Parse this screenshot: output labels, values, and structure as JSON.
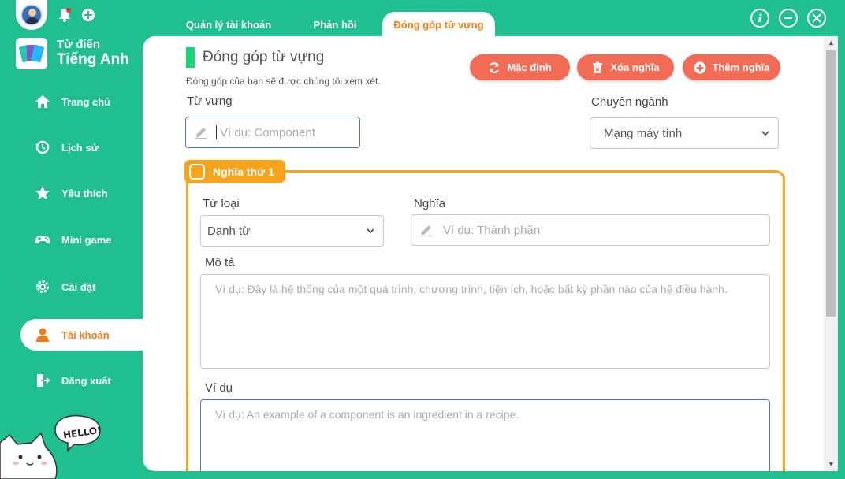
{
  "app": {
    "brand_line1": "Từ điển",
    "brand_line2": "Tiếng Anh"
  },
  "sidebar": {
    "items": [
      {
        "label": "Trang chủ",
        "icon": "home-icon"
      },
      {
        "label": "Lịch sử",
        "icon": "history-icon"
      },
      {
        "label": "Yêu thích",
        "icon": "star-icon"
      },
      {
        "label": "Mini game",
        "icon": "gamepad-icon"
      },
      {
        "label": "Cài đặt",
        "icon": "gear-icon"
      },
      {
        "label": "Tài khoản",
        "icon": "user-icon",
        "active": true
      },
      {
        "label": "Đăng xuất",
        "icon": "logout-icon"
      }
    ],
    "mascot_text": "HELLO!"
  },
  "tabs": [
    {
      "label": "Quản lý tài khoản"
    },
    {
      "label": "Phản hồi"
    },
    {
      "label": "Đóng góp từ vựng",
      "active": true
    }
  ],
  "page": {
    "title": "Đóng góp từ vựng",
    "subtitle": "Đóng góp của bạn sẽ được chúng tôi xem xét.",
    "buttons": {
      "default": "Mặc định",
      "delete": "Xóa nghĩa",
      "add": "Thêm nghĩa"
    },
    "vocab": {
      "label": "Từ vựng",
      "placeholder": "Ví dụ: Component"
    },
    "field": {
      "label": "Chuyên ngành",
      "value": "Mạng máy tính"
    },
    "meaning": {
      "badge": "Nghĩa thứ 1",
      "word_type": {
        "label": "Từ loại",
        "value": "Danh từ"
      },
      "meaning": {
        "label": "Nghĩa",
        "placeholder": "Ví dụ: Thành phần"
      },
      "description": {
        "label": "Mô tả",
        "placeholder": "Ví dụ: Đây là hệ thống của một quá trình, chương trình, tiện ích, hoặc bất kỳ phần nào của hệ điều hành."
      },
      "example": {
        "label": "Ví dụ",
        "placeholder": "Ví dụ: An example of a component is an ingredient in a recipe."
      }
    }
  },
  "colors": {
    "primary": "#1fbf8f",
    "accent": "#f07b17",
    "button": "#f16b55",
    "meaning_border": "#f7a41d"
  }
}
